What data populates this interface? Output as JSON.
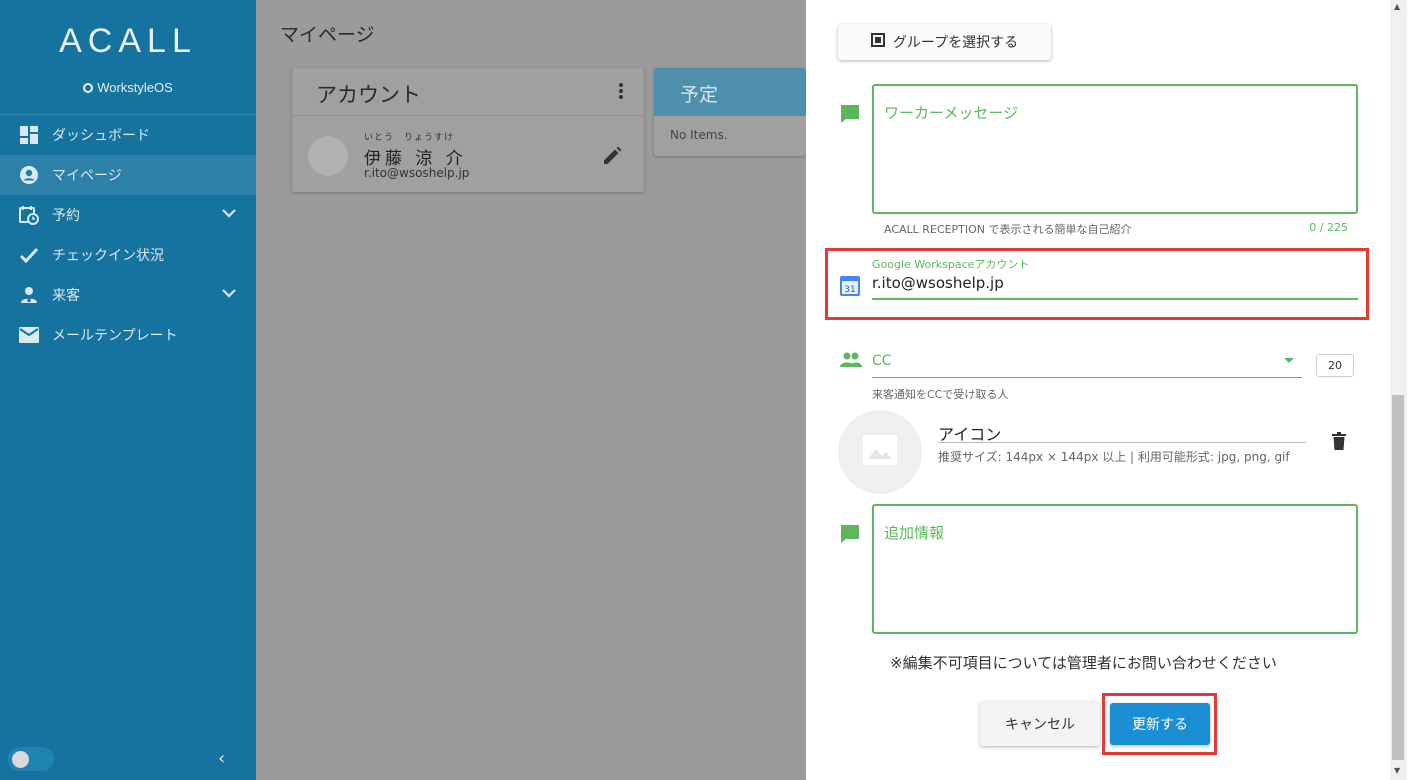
{
  "sidebar": {
    "logo": "ACALL",
    "subtitle": "WorkstyleOS",
    "items": [
      {
        "label": "ダッシュボード",
        "icon": "dashboard-icon"
      },
      {
        "label": "マイページ",
        "icon": "account-circle-icon"
      },
      {
        "label": "予約",
        "icon": "calendar-clock-icon"
      },
      {
        "label": "チェックイン状況",
        "icon": "check-icon"
      },
      {
        "label": "来客",
        "icon": "visitor-icon"
      },
      {
        "label": "メールテンプレート",
        "icon": "mail-icon"
      }
    ],
    "collapse_glyph": "‹"
  },
  "page": {
    "title": "マイページ"
  },
  "account_card": {
    "title": "アカウント",
    "name_ruby": "いとう　りょうすけ",
    "name": "伊藤 涼 介",
    "email": "r.ito@wsoshelp.jp"
  },
  "schedule_card": {
    "title": "予定",
    "empty": "No Items."
  },
  "panel": {
    "group_button": "グループを選択する",
    "worker_message_placeholder": "ワーカーメッセージ",
    "worker_message_hint": "ACALL RECEPTION で表示される簡単な自己紹介",
    "worker_message_counter": "0 / 225",
    "google_label": "Google Workspaceアカウント",
    "google_value": "r.ito@wsoshelp.jp",
    "calendar_icon_text": "31",
    "cc_label": "CC",
    "cc_hint": "来客通知をCCで受け取る人",
    "cc_count": "20",
    "icon_title": "アイコン",
    "icon_hint": "推奨サイズ: 144px × 144px 以上 | 利用可能形式: jpg, png, gif",
    "additional_info_placeholder": "追加情報",
    "notice": "※編集不可項目については管理者にお問い合わせください",
    "cancel": "キャンセル",
    "update": "更新する"
  },
  "colors": {
    "sidebar": "#16739f",
    "accent_green": "#5cb85c",
    "primary_blue": "#1a8fd6",
    "highlight_red": "#e53935"
  }
}
